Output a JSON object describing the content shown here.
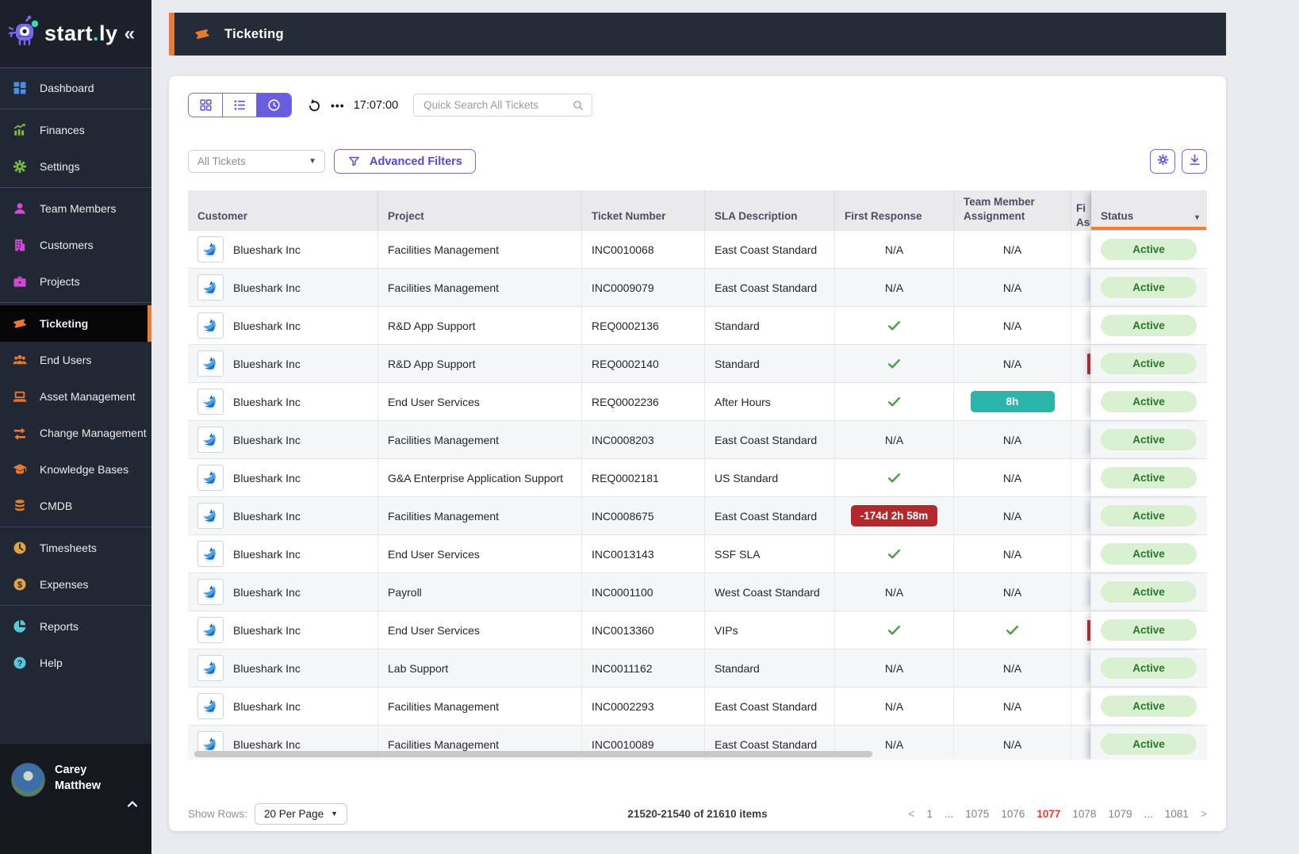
{
  "app": {
    "logo_pre": "start",
    "logo_dot": ".",
    "logo_post": "ly",
    "collapse_glyph": "«"
  },
  "sidebar": {
    "groups": [
      {
        "icon_color": "#4a8fe2",
        "items": [
          {
            "label": "Dashboard",
            "icon": "dashboard-icon"
          }
        ]
      },
      {
        "icon_color": "#7cc144",
        "items": [
          {
            "label": "Finances",
            "icon": "finances-icon"
          },
          {
            "label": "Settings",
            "icon": "settings-icon"
          }
        ]
      },
      {
        "icon_color": "#d14ad6",
        "items": [
          {
            "label": "Team Members",
            "icon": "team-members-icon"
          },
          {
            "label": "Customers",
            "icon": "customers-icon"
          },
          {
            "label": "Projects",
            "icon": "projects-icon"
          }
        ]
      },
      {
        "icon_color": "#e8792f",
        "items": [
          {
            "label": "Ticketing",
            "icon": "ticketing-icon",
            "active": true
          },
          {
            "label": "End Users",
            "icon": "end-users-icon"
          },
          {
            "label": "Asset Management",
            "icon": "asset-management-icon"
          },
          {
            "label": "Change Management",
            "icon": "change-management-icon"
          },
          {
            "label": "Knowledge Bases",
            "icon": "knowledge-bases-icon"
          },
          {
            "label": "CMDB",
            "icon": "cmdb-icon"
          }
        ]
      },
      {
        "icon_color": "#e2a33c",
        "items": [
          {
            "label": "Timesheets",
            "icon": "timesheets-icon"
          },
          {
            "label": "Expenses",
            "icon": "expenses-icon"
          }
        ]
      },
      {
        "icon_color": "#56c7dc",
        "items": [
          {
            "label": "Reports",
            "icon": "reports-icon"
          },
          {
            "label": "Help",
            "icon": "help-icon"
          }
        ]
      }
    ],
    "user": {
      "name": "Carey Matthew"
    }
  },
  "header": {
    "title": "Ticketing"
  },
  "toolbar": {
    "time": "17:07:00",
    "ellipsis": "•••",
    "search_placeholder": "Quick Search All Tickets"
  },
  "filters": {
    "ticket_filter_value": "All Tickets",
    "advanced_filters_label": "Advanced Filters"
  },
  "table": {
    "headers": {
      "customer": "Customer",
      "project": "Project",
      "ticket": "Ticket Number",
      "sla": "SLA Description",
      "first_response": "First Response",
      "team_line1": "Team Member",
      "team_line2": "Assignment",
      "trunc_line1": "Fi",
      "trunc_line2": "As",
      "status": "Status",
      "status_caret": "▾"
    },
    "rows": [
      {
        "customer": "Blueshark Inc",
        "project": "Facilities Management",
        "ticket": "INC0010068",
        "sla": "East Coast Standard",
        "first_response": {
          "kind": "text",
          "text": "N/A"
        },
        "team_assignment": {
          "kind": "text",
          "text": "N/A"
        },
        "status": "Active"
      },
      {
        "customer": "Blueshark Inc",
        "project": "Facilities Management",
        "ticket": "INC0009079",
        "sla": "East Coast Standard",
        "first_response": {
          "kind": "text",
          "text": "N/A"
        },
        "team_assignment": {
          "kind": "text",
          "text": "N/A"
        },
        "status": "Active"
      },
      {
        "customer": "Blueshark Inc",
        "project": "R&D App Support",
        "ticket": "REQ0002136",
        "sla": "Standard",
        "first_response": {
          "kind": "check"
        },
        "team_assignment": {
          "kind": "text",
          "text": "N/A"
        },
        "status": "Active"
      },
      {
        "customer": "Blueshark Inc",
        "project": "R&D App Support",
        "ticket": "REQ0002140",
        "sla": "Standard",
        "first_response": {
          "kind": "check"
        },
        "team_assignment": {
          "kind": "text",
          "text": "N/A"
        },
        "edge_marker": true,
        "status": "Active"
      },
      {
        "customer": "Blueshark Inc",
        "project": "End User Services",
        "ticket": "REQ0002236",
        "sla": "After Hours",
        "first_response": {
          "kind": "check"
        },
        "team_assignment": {
          "kind": "badge",
          "style": "teal",
          "text": "8h"
        },
        "status": "Active"
      },
      {
        "customer": "Blueshark Inc",
        "project": "Facilities Management",
        "ticket": "INC0008203",
        "sla": "East Coast Standard",
        "first_response": {
          "kind": "text",
          "text": "N/A"
        },
        "team_assignment": {
          "kind": "text",
          "text": "N/A"
        },
        "status": "Active"
      },
      {
        "customer": "Blueshark Inc",
        "project": "G&A Enterprise Application Support",
        "ticket": "REQ0002181",
        "sla": "US Standard",
        "first_response": {
          "kind": "check"
        },
        "team_assignment": {
          "kind": "text",
          "text": "N/A"
        },
        "status": "Active"
      },
      {
        "customer": "Blueshark Inc",
        "project": "Facilities Management",
        "ticket": "INC0008675",
        "sla": "East Coast Standard",
        "first_response": {
          "kind": "badge",
          "style": "danger",
          "text": "-174d 2h 58m"
        },
        "team_assignment": {
          "kind": "text",
          "text": "N/A"
        },
        "status": "Active"
      },
      {
        "customer": "Blueshark Inc",
        "project": "End User Services",
        "ticket": "INC0013143",
        "sla": "SSF SLA",
        "first_response": {
          "kind": "check"
        },
        "team_assignment": {
          "kind": "text",
          "text": "N/A"
        },
        "status": "Active"
      },
      {
        "customer": "Blueshark Inc",
        "project": "Payroll",
        "ticket": "INC0001100",
        "sla": "West Coast Standard",
        "first_response": {
          "kind": "text",
          "text": "N/A"
        },
        "team_assignment": {
          "kind": "text",
          "text": "N/A"
        },
        "status": "Active"
      },
      {
        "customer": "Blueshark Inc",
        "project": "End User Services",
        "ticket": "INC0013360",
        "sla": "VIPs",
        "first_response": {
          "kind": "check"
        },
        "team_assignment": {
          "kind": "check"
        },
        "edge_marker": true,
        "status": "Active"
      },
      {
        "customer": "Blueshark Inc",
        "project": "Lab Support",
        "ticket": "INC0011162",
        "sla": "Standard",
        "first_response": {
          "kind": "text",
          "text": "N/A"
        },
        "team_assignment": {
          "kind": "text",
          "text": "N/A"
        },
        "status": "Active"
      },
      {
        "customer": "Blueshark Inc",
        "project": "Facilities Management",
        "ticket": "INC0002293",
        "sla": "East Coast Standard",
        "first_response": {
          "kind": "text",
          "text": "N/A"
        },
        "team_assignment": {
          "kind": "text",
          "text": "N/A"
        },
        "status": "Active"
      },
      {
        "customer": "Blueshark Inc",
        "project": "Facilities Management",
        "ticket": "INC0010089",
        "sla": "East Coast Standard",
        "first_response": {
          "kind": "text",
          "text": "N/A"
        },
        "team_assignment": {
          "kind": "text",
          "text": "N/A"
        },
        "status": "Active"
      }
    ]
  },
  "footer": {
    "show_rows_label": "Show Rows:",
    "per_page_value": "20 Per Page",
    "items_summary": "21520-21540 of 21610 items",
    "pagination": {
      "prev": "<",
      "next": ">",
      "pages": [
        "1",
        "...",
        "1075",
        "1076",
        "1077",
        "1078",
        "1079",
        "...",
        "1081"
      ],
      "active_page": "1077"
    }
  },
  "colors": {
    "accent_purple": "#6a5ce0",
    "accent_orange": "#e87d3a",
    "status_green_bg": "#d9f1d0",
    "status_green_text": "#27742a",
    "danger_red": "#b3282d",
    "teal": "#2ab5ab",
    "check_green": "#3fa33f",
    "pagination_active": "#e5412d"
  }
}
